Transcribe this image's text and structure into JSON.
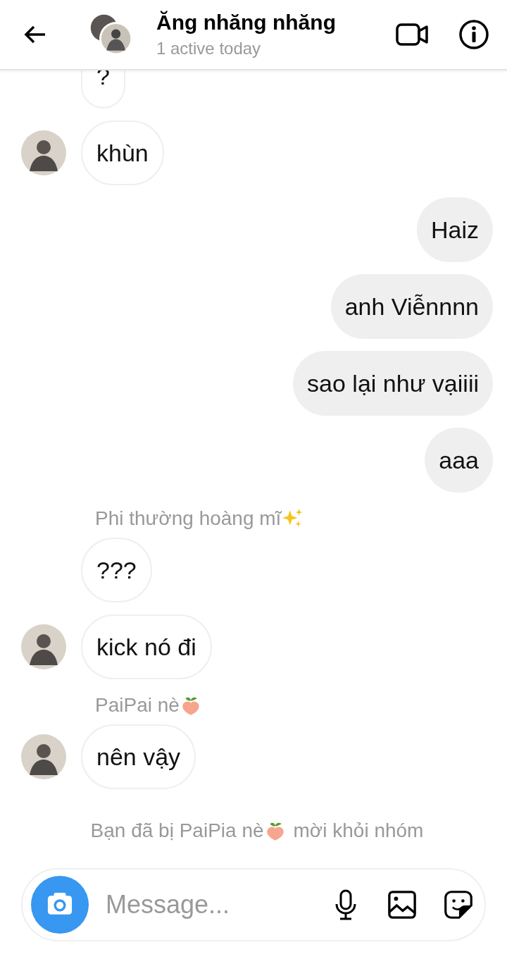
{
  "header": {
    "title": "Ăng nhăng nhăng",
    "subtitle": "1 active today"
  },
  "messages": [
    {
      "kind": "incoming",
      "text": "?",
      "avatar": false
    },
    {
      "kind": "incoming",
      "text": "khùn",
      "avatar": true
    },
    {
      "kind": "outgoing",
      "text": "Haiz"
    },
    {
      "kind": "outgoing",
      "text": "anh Viễnnnn"
    },
    {
      "kind": "outgoing",
      "text": "sao lại như vạiiii"
    },
    {
      "kind": "outgoing",
      "text": "aaa"
    },
    {
      "kind": "sender",
      "text": "Phi thường hoàng mĩ"
    },
    {
      "kind": "incoming",
      "text": "???",
      "avatar": false
    },
    {
      "kind": "incoming",
      "text": "kick nó đi",
      "avatar": true
    },
    {
      "kind": "sender",
      "text": "PaiPai nè"
    },
    {
      "kind": "incoming",
      "text": "nên vậy",
      "avatar": true
    },
    {
      "kind": "system",
      "before": "Bạn đã bị PaiPia nè",
      "after": "mời khỏi nhóm"
    }
  ],
  "composer": {
    "placeholder": "Message..."
  }
}
